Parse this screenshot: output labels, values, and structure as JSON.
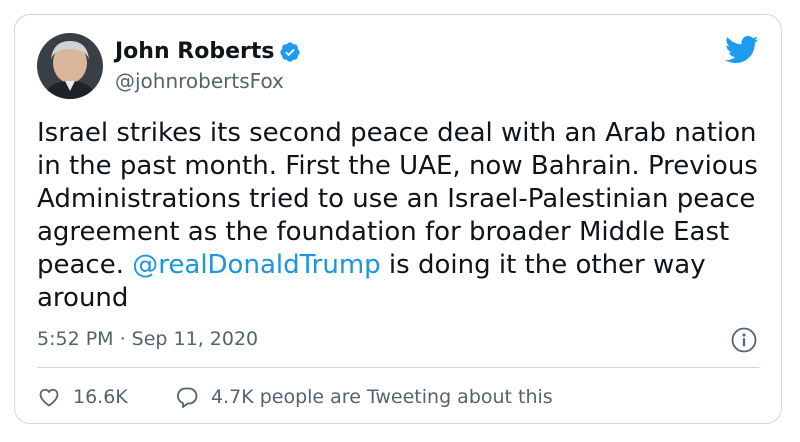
{
  "author": {
    "name": "John Roberts",
    "handle": "@johnrobertsFox"
  },
  "tweet": {
    "text_before": "Israel strikes its second peace deal with an Arab nation in the past month. First the UAE, now Bahrain. Previous Administrations tried to use an Israel-Palestinian peace agreement as the foundation for broader Middle East peace. ",
    "mention": "@realDonaldTrump",
    "text_after": " is doing it the other way around"
  },
  "meta": {
    "timestamp": "5:52 PM · Sep 11, 2020"
  },
  "actions": {
    "likes": "16.6K",
    "conversation": "4.7K people are Tweeting about this"
  },
  "colors": {
    "accent": "#1b95e0",
    "text": "#0f1419",
    "muted": "#536471",
    "border": "#cfd9de"
  }
}
